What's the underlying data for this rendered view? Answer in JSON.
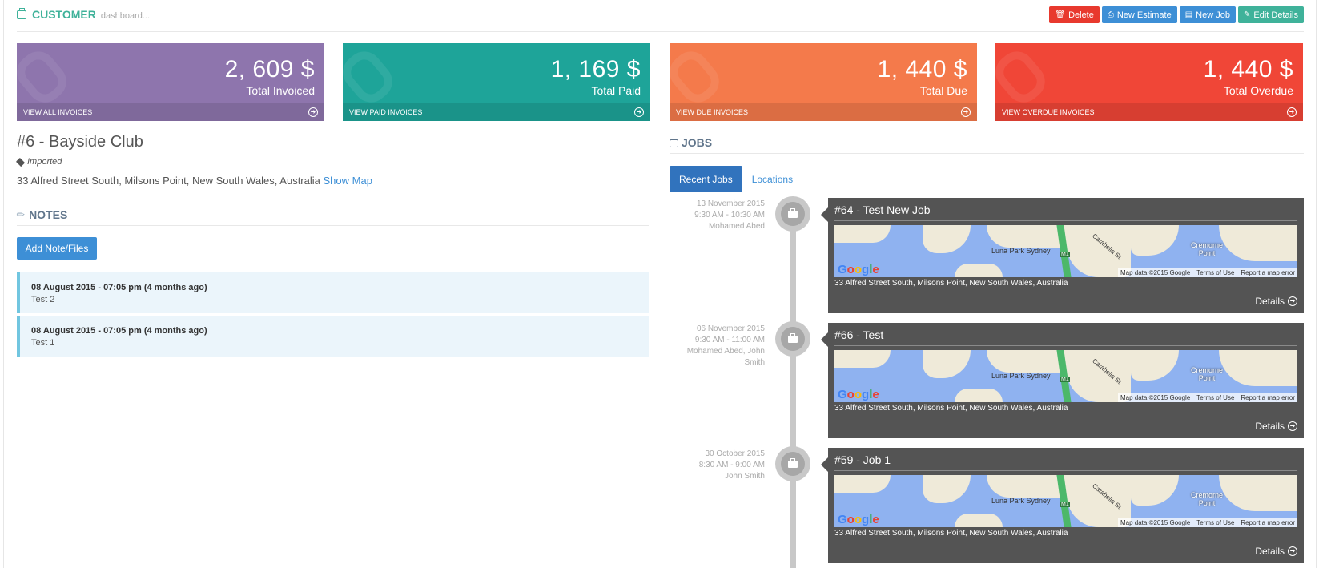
{
  "header": {
    "title": "CUSTOMER",
    "subtitle": "dashboard...",
    "actions": {
      "delete": "Delete",
      "new_estimate": "New Estimate",
      "new_job": "New Job",
      "edit_details": "Edit Details"
    }
  },
  "tiles": [
    {
      "value": "2, 609 $",
      "label": "Total Invoiced",
      "link": "VIEW ALL INVOICES",
      "color": "#8e75ad"
    },
    {
      "value": "1, 169 $",
      "label": "Total Paid",
      "link": "VIEW PAID INVOICES",
      "color": "#1ea499"
    },
    {
      "value": "1, 440 $",
      "label": "Total Due",
      "link": "VIEW DUE INVOICES",
      "color": "#f47a4b"
    },
    {
      "value": "1, 440 $",
      "label": "Total Overdue",
      "link": "VIEW OVERDUE INVOICES",
      "color": "#f04637"
    }
  ],
  "customer": {
    "name": "#6 - Bayside Club",
    "tag": "Imported",
    "address": "33 Alfred Street South, Milsons Point, New South Wales, Australia",
    "show_map": "Show Map"
  },
  "notes": {
    "title": "NOTES",
    "add_button": "Add Note/Files",
    "items": [
      {
        "date": "08 August 2015 - 07:05 pm (4 months ago)",
        "text": "Test 2"
      },
      {
        "date": "08 August 2015 - 07:05 pm (4 months ago)",
        "text": "Test 1"
      }
    ]
  },
  "jobs": {
    "title": "JOBS",
    "tabs": [
      "Recent Jobs",
      "Locations"
    ],
    "active_tab": "Recent Jobs",
    "items": [
      {
        "date": "13 November 2015",
        "time": "9:30 AM - 10:30 AM",
        "staff": "Mohamed Abed",
        "title": "#64 - Test New Job",
        "address": "33 Alfred Street South, Milsons Point, New South Wales, Australia",
        "details": "Details"
      },
      {
        "date": "06 November 2015",
        "time": "9:30 AM - 11:00 AM",
        "staff": "Mohamed Abed, John Smith",
        "title": "#66 - Test",
        "address": "33 Alfred Street South, Milsons Point, New South Wales, Australia",
        "details": "Details"
      },
      {
        "date": "30 October 2015",
        "time": "8:30 AM - 9:00 AM",
        "staff": "John Smith",
        "title": "#59 - Job 1",
        "address": "33 Alfred Street South, Milsons Point, New South Wales, Australia",
        "details": "Details"
      }
    ],
    "map_labels": {
      "place": "Luna Park Sydney",
      "point": "Cremorne Point",
      "street": "Carabella St",
      "road": "M1",
      "credits": [
        "Map data ©2015 Google",
        "Terms of Use",
        "Report a map error"
      ]
    }
  }
}
